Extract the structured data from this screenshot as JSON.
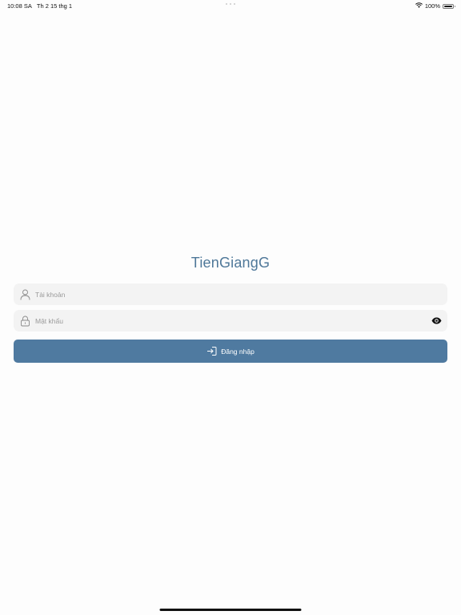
{
  "status_bar": {
    "time": "10:08 SA",
    "date": "Th 2 15 thg 1",
    "battery": "100%",
    "battery_level": 1.0
  },
  "app": {
    "title": "TienGiangG"
  },
  "login_form": {
    "username": {
      "placeholder": "Tài khoản",
      "value": "",
      "icon": "user-icon"
    },
    "password": {
      "placeholder": "Mật khẩu",
      "value": "",
      "icon": "lock-icon",
      "toggle_icon": "eye-icon"
    },
    "submit": {
      "label": "Đăng nhập",
      "icon": "login-icon"
    }
  },
  "colors": {
    "accent": "#4f7aa0",
    "title": "#4f7899",
    "field_background": "#f3f3f3",
    "placeholder": "#9a9a9a"
  }
}
